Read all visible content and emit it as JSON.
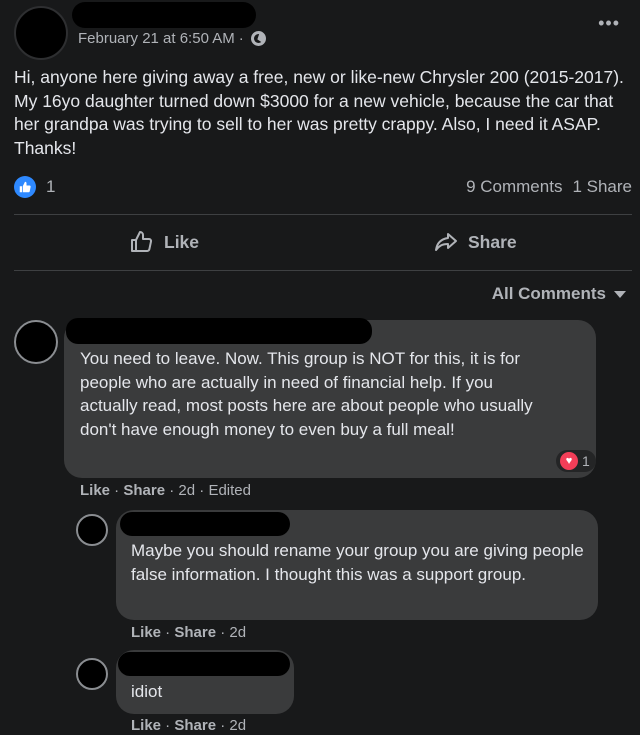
{
  "post": {
    "timestamp": "February 21 at 6:50 AM",
    "separator": "·",
    "audience_icon": "globe-icon",
    "more_icon": "more-horizontal-icon",
    "more_label": "•••",
    "text": "Hi, anyone here giving away a free, new or like-new Chrysler 200 (2015-2017). My 16yo daughter turned down $3000 for a new vehicle, because the car that her grandpa was trying to sell to her was pretty crappy. Also, I need it ASAP. Thanks!",
    "reaction_count": "1",
    "comments_count": "9 Comments",
    "shares_count": "1 Share",
    "like_label": "Like",
    "share_label": "Share",
    "all_comments_label": "All Comments"
  },
  "comments": [
    {
      "text": "You need to leave. Now. This group is NOT for this, it is for people who are actually in need of financial help. If you actually read, most posts here are about people who usually don't have enough money to even buy a full meal!",
      "like_label": "Like",
      "share_label": "Share",
      "time": "2d",
      "edited": "Edited",
      "reaction_count": "1"
    },
    {
      "text": "Maybe you should rename your group you are giving people false information. I thought this was a support group.",
      "like_label": "Like",
      "share_label": "Share",
      "time": "2d"
    },
    {
      "text": "idiot",
      "like_label": "Like",
      "share_label": "Share",
      "time": "2d"
    }
  ],
  "colors": {
    "background": "#18191a",
    "bubble": "#3a3b3c",
    "like_blue": "#2e89ff",
    "love_red": "#f33e58"
  }
}
